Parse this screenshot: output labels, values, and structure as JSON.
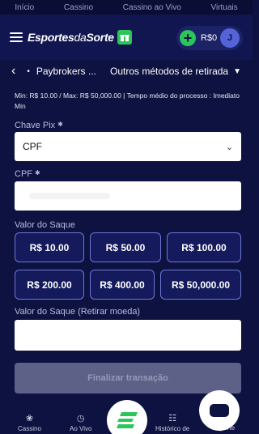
{
  "top_nav": [
    "Início",
    "Cassino",
    "Cassino ao Vivo",
    "Virtuais"
  ],
  "header": {
    "logo_main": "Esportes",
    "logo_mid": "da",
    "logo_end": "Sorte",
    "balance": "R$0",
    "avatar_initial": "J"
  },
  "breadcrumb": {
    "provider": "Paybrokers ...",
    "method": "Outros métodos de retirada"
  },
  "limits_text": "Min: R$ 10.00 / Max: R$ 50,000.00 | Tempo médio do processo : Imediato Min",
  "form": {
    "pix_key_label": "Chave Pix",
    "pix_key_value": "CPF",
    "cpf_label": "CPF",
    "amount_label": "Valor do Saque",
    "amount_options_row1": [
      "R$ 10.00",
      "R$ 50.00",
      "R$ 100.00"
    ],
    "amount_options_row2": [
      "R$ 200.00",
      "R$ 400.00",
      "R$ 50,000.00"
    ],
    "currency_amount_label": "Valor do Saque (Retirar moeda)",
    "submit_label": "Finalizar transação"
  },
  "bottom_nav": {
    "casino": "Cassino",
    "live": "Ao Vivo",
    "history": "Histórico de",
    "support": "Suporte"
  },
  "colors": {
    "background": "#0d1240",
    "accent_green": "#2cc55a",
    "amount_border": "#6d78d6"
  }
}
